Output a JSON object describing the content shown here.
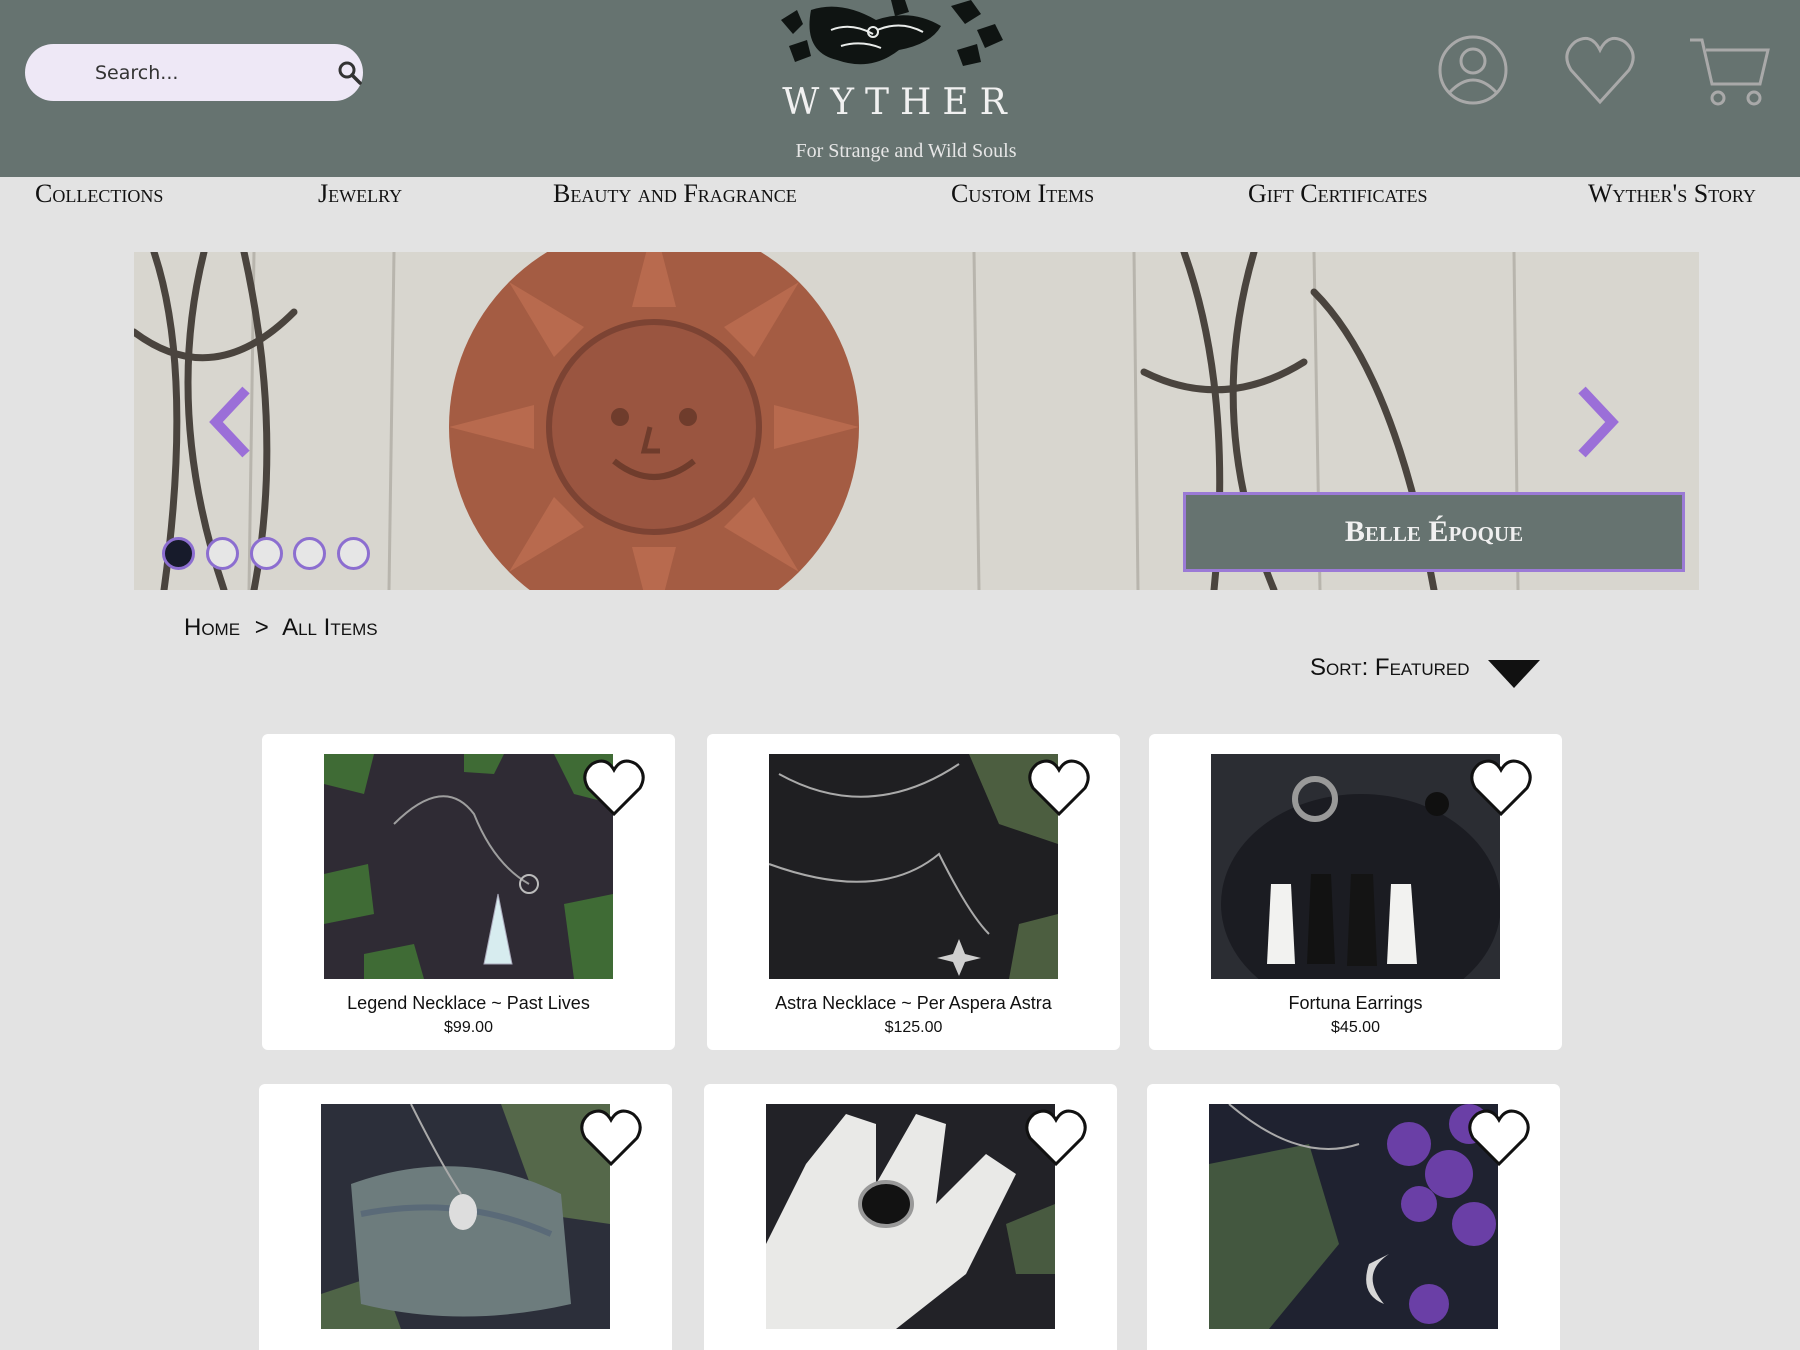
{
  "search": {
    "placeholder": "Search..."
  },
  "brand": {
    "name": "WYTHER",
    "tagline": "For Strange and Wild Souls"
  },
  "header_icons": [
    "account-icon",
    "heart-icon",
    "cart-icon"
  ],
  "nav": [
    "Collections",
    "Jewelry",
    "Beauty and Fragrance",
    "Custom Items",
    "Gift Certificates",
    "Wyther's Story"
  ],
  "carousel": {
    "caption": "Belle Époque",
    "slide_count": 5,
    "active_slide": 1
  },
  "breadcrumb": {
    "home": "Home",
    "sep": ">",
    "current": "All Items"
  },
  "sort": {
    "label": "Sort: Featured"
  },
  "products": [
    {
      "name": "Legend Necklace ~ Past Lives",
      "price": "$99.00"
    },
    {
      "name": "Astra Necklace ~ Per Aspera Astra",
      "price": "$125.00"
    },
    {
      "name": "Fortuna Earrings",
      "price": "$45.00"
    },
    {
      "name": "",
      "price": ""
    },
    {
      "name": "",
      "price": ""
    },
    {
      "name": "",
      "price": ""
    }
  ],
  "colors": {
    "header_bg": "#667370",
    "accent": "#9b7ad6",
    "page_bg": "#e3e3e3"
  }
}
